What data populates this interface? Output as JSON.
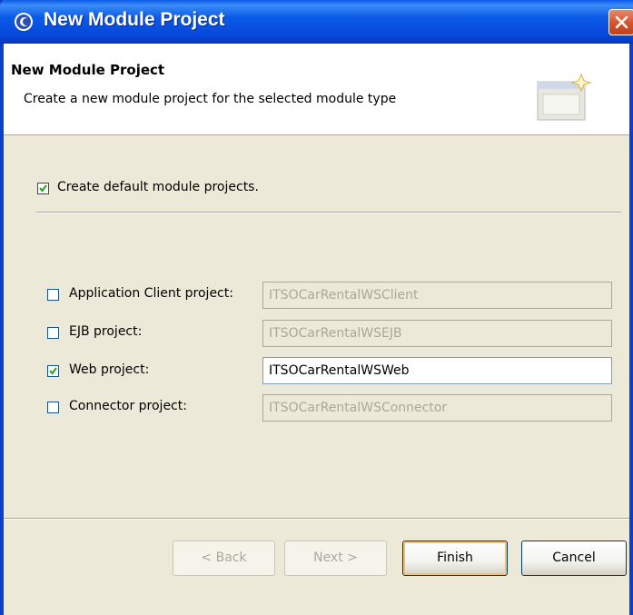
{
  "window": {
    "title": "New Module Project"
  },
  "banner": {
    "title": "New Module Project",
    "description": "Create a new module project for the selected module type"
  },
  "default_projects": {
    "label": "Create default module projects.",
    "checked": true
  },
  "modules": [
    {
      "label": "Application Client project:",
      "checked": false,
      "value": "ITSOCarRentalWSClient",
      "enabled": false
    },
    {
      "label": "EJB project:",
      "checked": false,
      "value": "ITSOCarRentalWSEJB",
      "enabled": false
    },
    {
      "label": "Web project:",
      "checked": true,
      "value": "ITSOCarRentalWSWeb",
      "enabled": true
    },
    {
      "label": "Connector project:",
      "checked": false,
      "value": "ITSOCarRentalWSConnector",
      "enabled": false
    }
  ],
  "buttons": {
    "back": "< Back",
    "next": "Next >",
    "finish": "Finish",
    "cancel": "Cancel"
  },
  "colors": {
    "titlebar": "#0a5ae8",
    "window_bg": "#ece9d8",
    "disabled_text": "#aca899"
  },
  "icons": {
    "app": "eclipse-icon",
    "close": "close-icon",
    "banner": "wizard-icon"
  }
}
